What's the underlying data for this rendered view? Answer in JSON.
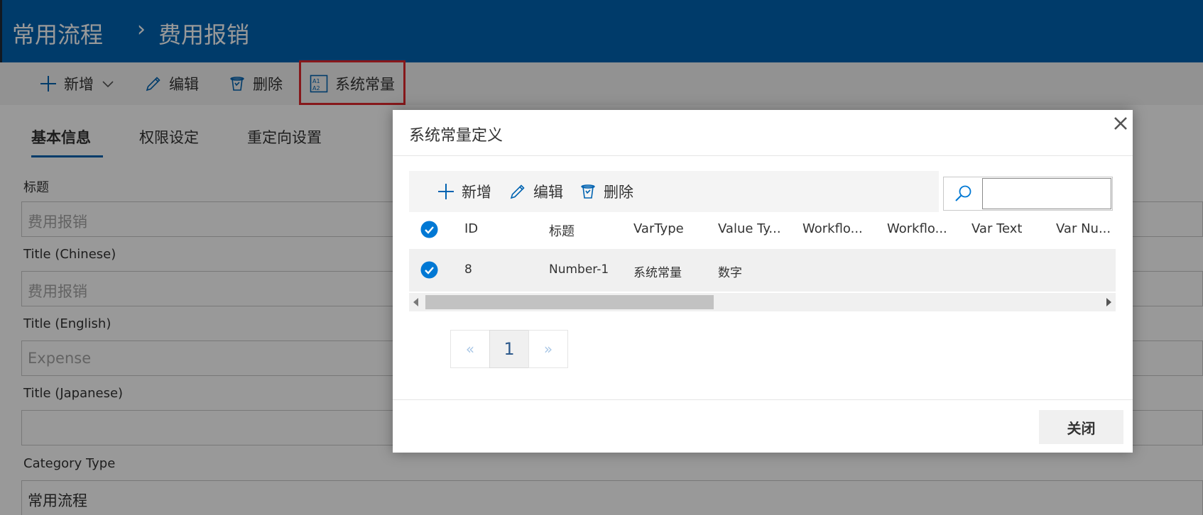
{
  "header": {
    "breadcrumb_root": "常用流程",
    "breadcrumb_separator": "›",
    "breadcrumb_current": "费用报销"
  },
  "toolbar": {
    "add_label": "新增",
    "edit_label": "编辑",
    "delete_label": "删除",
    "constants_label": "系统常量"
  },
  "tabs": [
    {
      "label": "基本信息",
      "active": true
    },
    {
      "label": "权限设定",
      "active": false
    },
    {
      "label": "重定向设置",
      "active": false
    }
  ],
  "form": {
    "fields": [
      {
        "label": "标题",
        "value": "费用报销"
      },
      {
        "label": "Title (Chinese)",
        "value": "费用报销"
      },
      {
        "label": "Title (English)",
        "value": "Expense"
      },
      {
        "label": "Title (Japanese)",
        "value": ""
      },
      {
        "label": "Category Type",
        "value": "常用流程"
      }
    ]
  },
  "modal": {
    "title": "系统常量定义",
    "toolbar": {
      "add_label": "新增",
      "edit_label": "编辑",
      "delete_label": "删除"
    },
    "search": {
      "value": "",
      "placeholder": ""
    },
    "columns": [
      "ID",
      "标题",
      "VarType",
      "Value Ty...",
      "Workflo...",
      "Workflo...",
      "Var Text",
      "Var Nu..."
    ],
    "rows": [
      {
        "id": "8",
        "title": "Number-1",
        "var_type": "系统常量",
        "value_type": "数字",
        "workflow1": "",
        "workflow2": "",
        "var_text": "",
        "var_number": "",
        "checked": true
      }
    ],
    "pager": {
      "prev": "«",
      "current": "1",
      "next": "»"
    },
    "close_label": "关闭"
  },
  "colors": {
    "header_bg": "#0063b1",
    "accent": "#0078d4",
    "highlight_border": "#e0282e",
    "toolbar_bg": "#f4f4f4"
  }
}
